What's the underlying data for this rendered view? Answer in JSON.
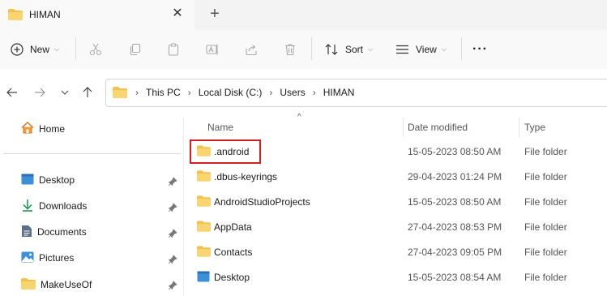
{
  "window": {
    "tab_title": "HIMAN",
    "close_glyph": "✕",
    "new_tab_glyph": "+"
  },
  "toolbar": {
    "new_label": "New",
    "sort_label": "Sort",
    "view_label": "View",
    "more_glyph": "···",
    "caret_glyph": "⌵"
  },
  "breadcrumb": {
    "items": [
      "This PC",
      "Local Disk (C:)",
      "Users",
      "HIMAN"
    ],
    "separator": "›"
  },
  "sidebar": {
    "home_label": "Home",
    "items": [
      {
        "label": "Desktop",
        "icon": "desktop-icon"
      },
      {
        "label": "Downloads",
        "icon": "download-icon"
      },
      {
        "label": "Documents",
        "icon": "documents-icon"
      },
      {
        "label": "Pictures",
        "icon": "pictures-icon"
      },
      {
        "label": "MakeUseOf",
        "icon": "folder-icon"
      }
    ]
  },
  "columns": {
    "name": "Name",
    "date_modified": "Date modified",
    "type": "Type",
    "sort_glyph": "^"
  },
  "files": [
    {
      "name": ".android",
      "date": "15-05-2023 08:50 AM",
      "type": "File folder",
      "icon": "folder-icon"
    },
    {
      "name": ".dbus-keyrings",
      "date": "29-04-2023 01:24 PM",
      "type": "File folder",
      "icon": "folder-icon"
    },
    {
      "name": "AndroidStudioProjects",
      "date": "15-05-2023 08:50 AM",
      "type": "File folder",
      "icon": "folder-icon"
    },
    {
      "name": "AppData",
      "date": "27-04-2023 08:53 PM",
      "type": "File folder",
      "icon": "folder-icon"
    },
    {
      "name": "Contacts",
      "date": "27-04-2023 09:05 PM",
      "type": "File folder",
      "icon": "folder-icon"
    },
    {
      "name": "Desktop",
      "date": "15-05-2023 08:54 AM",
      "type": "File folder",
      "icon": "desktop-icon"
    }
  ],
  "colors": {
    "folder": "#f4c24a",
    "highlight": "#d21f22",
    "desktop": "#3d8fd8"
  }
}
